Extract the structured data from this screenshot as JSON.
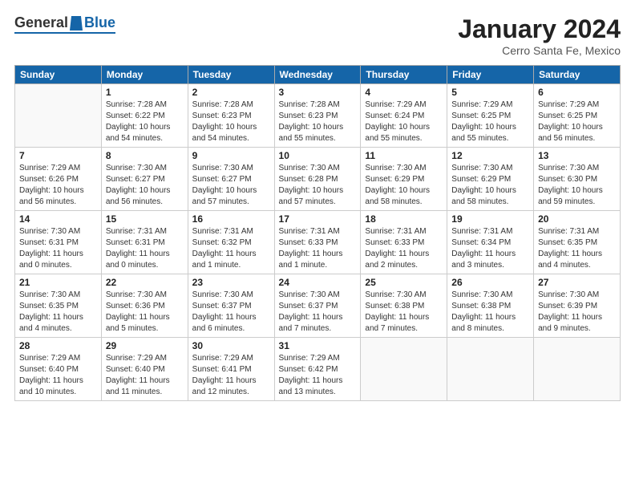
{
  "header": {
    "logo_general": "General",
    "logo_blue": "Blue",
    "title": "January 2024",
    "subtitle": "Cerro Santa Fe, Mexico"
  },
  "weekdays": [
    "Sunday",
    "Monday",
    "Tuesday",
    "Wednesday",
    "Thursday",
    "Friday",
    "Saturday"
  ],
  "weeks": [
    [
      {
        "day": "",
        "info": ""
      },
      {
        "day": "1",
        "info": "Sunrise: 7:28 AM\nSunset: 6:22 PM\nDaylight: 10 hours\nand 54 minutes."
      },
      {
        "day": "2",
        "info": "Sunrise: 7:28 AM\nSunset: 6:23 PM\nDaylight: 10 hours\nand 54 minutes."
      },
      {
        "day": "3",
        "info": "Sunrise: 7:28 AM\nSunset: 6:23 PM\nDaylight: 10 hours\nand 55 minutes."
      },
      {
        "day": "4",
        "info": "Sunrise: 7:29 AM\nSunset: 6:24 PM\nDaylight: 10 hours\nand 55 minutes."
      },
      {
        "day": "5",
        "info": "Sunrise: 7:29 AM\nSunset: 6:25 PM\nDaylight: 10 hours\nand 55 minutes."
      },
      {
        "day": "6",
        "info": "Sunrise: 7:29 AM\nSunset: 6:25 PM\nDaylight: 10 hours\nand 56 minutes."
      }
    ],
    [
      {
        "day": "7",
        "info": "Sunrise: 7:29 AM\nSunset: 6:26 PM\nDaylight: 10 hours\nand 56 minutes."
      },
      {
        "day": "8",
        "info": "Sunrise: 7:30 AM\nSunset: 6:27 PM\nDaylight: 10 hours\nand 56 minutes."
      },
      {
        "day": "9",
        "info": "Sunrise: 7:30 AM\nSunset: 6:27 PM\nDaylight: 10 hours\nand 57 minutes."
      },
      {
        "day": "10",
        "info": "Sunrise: 7:30 AM\nSunset: 6:28 PM\nDaylight: 10 hours\nand 57 minutes."
      },
      {
        "day": "11",
        "info": "Sunrise: 7:30 AM\nSunset: 6:29 PM\nDaylight: 10 hours\nand 58 minutes."
      },
      {
        "day": "12",
        "info": "Sunrise: 7:30 AM\nSunset: 6:29 PM\nDaylight: 10 hours\nand 58 minutes."
      },
      {
        "day": "13",
        "info": "Sunrise: 7:30 AM\nSunset: 6:30 PM\nDaylight: 10 hours\nand 59 minutes."
      }
    ],
    [
      {
        "day": "14",
        "info": "Sunrise: 7:30 AM\nSunset: 6:31 PM\nDaylight: 11 hours\nand 0 minutes."
      },
      {
        "day": "15",
        "info": "Sunrise: 7:31 AM\nSunset: 6:31 PM\nDaylight: 11 hours\nand 0 minutes."
      },
      {
        "day": "16",
        "info": "Sunrise: 7:31 AM\nSunset: 6:32 PM\nDaylight: 11 hours\nand 1 minute."
      },
      {
        "day": "17",
        "info": "Sunrise: 7:31 AM\nSunset: 6:33 PM\nDaylight: 11 hours\nand 1 minute."
      },
      {
        "day": "18",
        "info": "Sunrise: 7:31 AM\nSunset: 6:33 PM\nDaylight: 11 hours\nand 2 minutes."
      },
      {
        "day": "19",
        "info": "Sunrise: 7:31 AM\nSunset: 6:34 PM\nDaylight: 11 hours\nand 3 minutes."
      },
      {
        "day": "20",
        "info": "Sunrise: 7:31 AM\nSunset: 6:35 PM\nDaylight: 11 hours\nand 4 minutes."
      }
    ],
    [
      {
        "day": "21",
        "info": "Sunrise: 7:30 AM\nSunset: 6:35 PM\nDaylight: 11 hours\nand 4 minutes."
      },
      {
        "day": "22",
        "info": "Sunrise: 7:30 AM\nSunset: 6:36 PM\nDaylight: 11 hours\nand 5 minutes."
      },
      {
        "day": "23",
        "info": "Sunrise: 7:30 AM\nSunset: 6:37 PM\nDaylight: 11 hours\nand 6 minutes."
      },
      {
        "day": "24",
        "info": "Sunrise: 7:30 AM\nSunset: 6:37 PM\nDaylight: 11 hours\nand 7 minutes."
      },
      {
        "day": "25",
        "info": "Sunrise: 7:30 AM\nSunset: 6:38 PM\nDaylight: 11 hours\nand 7 minutes."
      },
      {
        "day": "26",
        "info": "Sunrise: 7:30 AM\nSunset: 6:38 PM\nDaylight: 11 hours\nand 8 minutes."
      },
      {
        "day": "27",
        "info": "Sunrise: 7:30 AM\nSunset: 6:39 PM\nDaylight: 11 hours\nand 9 minutes."
      }
    ],
    [
      {
        "day": "28",
        "info": "Sunrise: 7:29 AM\nSunset: 6:40 PM\nDaylight: 11 hours\nand 10 minutes."
      },
      {
        "day": "29",
        "info": "Sunrise: 7:29 AM\nSunset: 6:40 PM\nDaylight: 11 hours\nand 11 minutes."
      },
      {
        "day": "30",
        "info": "Sunrise: 7:29 AM\nSunset: 6:41 PM\nDaylight: 11 hours\nand 12 minutes."
      },
      {
        "day": "31",
        "info": "Sunrise: 7:29 AM\nSunset: 6:42 PM\nDaylight: 11 hours\nand 13 minutes."
      },
      {
        "day": "",
        "info": ""
      },
      {
        "day": "",
        "info": ""
      },
      {
        "day": "",
        "info": ""
      }
    ]
  ]
}
